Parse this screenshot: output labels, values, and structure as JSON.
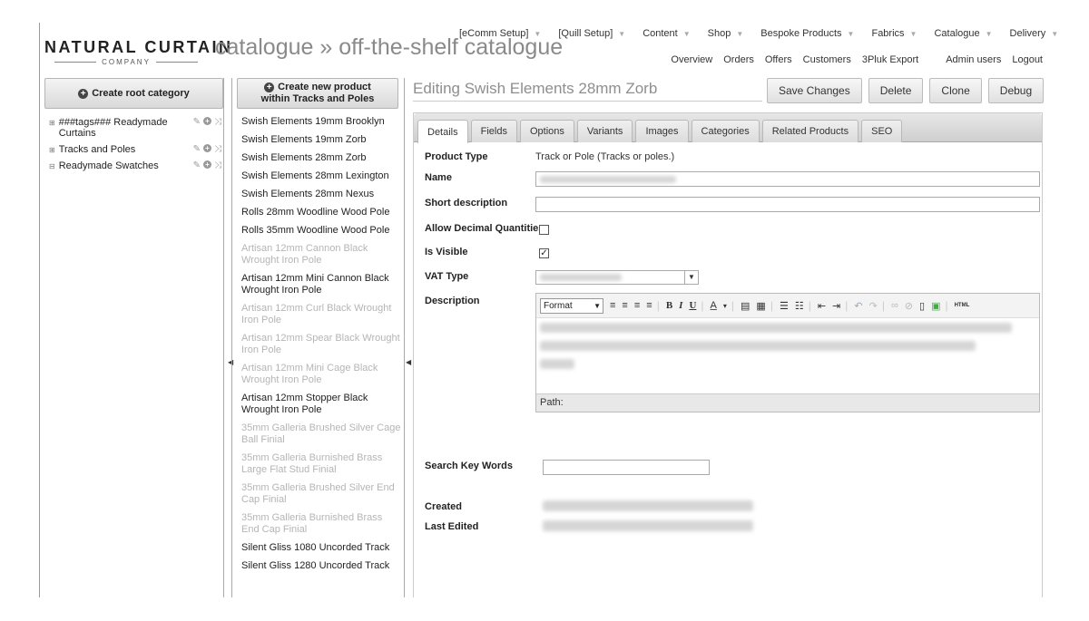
{
  "header": {
    "brand": "NATURAL CURTAIN",
    "company": "COMPANY",
    "page_title": "catalogue » off-the-shelf catalogue"
  },
  "top_nav": [
    "[eComm Setup]",
    "[Quill Setup]",
    "Content",
    "Shop",
    "Bespoke Products",
    "Fabrics",
    "Catalogue",
    "Delivery"
  ],
  "sub_nav": [
    "Overview",
    "Orders",
    "Offers",
    "Customers",
    "3Pluk Export",
    "Admin users",
    "Logout"
  ],
  "categories": {
    "create_label": "Create root category",
    "items": [
      {
        "label": "###tags### Readymade Curtains"
      },
      {
        "label": "Tracks and Poles"
      },
      {
        "label": "Readymade Swatches"
      }
    ]
  },
  "products": {
    "create_line1": "Create new product",
    "create_line2": "within Tracks and Poles",
    "items": [
      {
        "label": "Swish Elements 19mm Brooklyn",
        "disabled": false
      },
      {
        "label": "Swish Elements 19mm Zorb",
        "disabled": false
      },
      {
        "label": "Swish Elements 28mm Zorb",
        "disabled": false
      },
      {
        "label": "Swish Elements 28mm Lexington",
        "disabled": false
      },
      {
        "label": "Swish Elements 28mm Nexus",
        "disabled": false
      },
      {
        "label": "Rolls 28mm Woodline Wood Pole",
        "disabled": false
      },
      {
        "label": "Rolls 35mm Woodline Wood Pole",
        "disabled": false
      },
      {
        "label": "Artisan 12mm Cannon Black Wrought Iron Pole",
        "disabled": true
      },
      {
        "label": "Artisan 12mm Mini Cannon Black Wrought Iron Pole",
        "disabled": false
      },
      {
        "label": "Artisan 12mm Curl Black Wrought Iron Pole",
        "disabled": true
      },
      {
        "label": "Artisan 12mm Spear Black Wrought Iron Pole",
        "disabled": true
      },
      {
        "label": "Artisan 12mm Mini Cage Black Wrought Iron Pole",
        "disabled": true
      },
      {
        "label": "Artisan 12mm Stopper Black Wrought Iron Pole",
        "disabled": false
      },
      {
        "label": "35mm Galleria Brushed Silver Cage Ball Finial",
        "disabled": true
      },
      {
        "label": "35mm Galleria Burnished Brass Large Flat Stud Finial",
        "disabled": true
      },
      {
        "label": "35mm Galleria Brushed Silver End Cap Finial",
        "disabled": true
      },
      {
        "label": "35mm Galleria Burnished Brass End Cap Finial",
        "disabled": true
      },
      {
        "label": "Silent Gliss 1080 Uncorded Track",
        "disabled": false
      },
      {
        "label": "Silent Gliss 1280 Uncorded Track",
        "disabled": false
      }
    ]
  },
  "editor": {
    "title": "Editing Swish Elements 28mm Zorb",
    "actions": [
      "Save Changes",
      "Delete",
      "Clone",
      "Debug"
    ],
    "tabs": [
      "Details",
      "Fields",
      "Options",
      "Variants",
      "Images",
      "Categories",
      "Related Products",
      "SEO"
    ],
    "active_tab": "Details",
    "fields": {
      "product_type_label": "Product Type",
      "product_type_value": "Track or Pole (Tracks or poles.)",
      "name_label": "Name",
      "short_desc_label": "Short description",
      "allow_decimal_label": "Allow Decimal Quantities",
      "allow_decimal_checked": false,
      "is_visible_label": "Is Visible",
      "is_visible_checked": true,
      "vat_type_label": "VAT Type",
      "description_label": "Description",
      "format_label": "Format",
      "path_label": "Path:",
      "search_keywords_label": "Search Key Words",
      "created_label": "Created",
      "last_edited_label": "Last Edited"
    }
  },
  "colors": {
    "disabled_text": "#b5b5b5",
    "title_grey": "#8a8a8a",
    "tab_bar": "#d6d6d6"
  }
}
